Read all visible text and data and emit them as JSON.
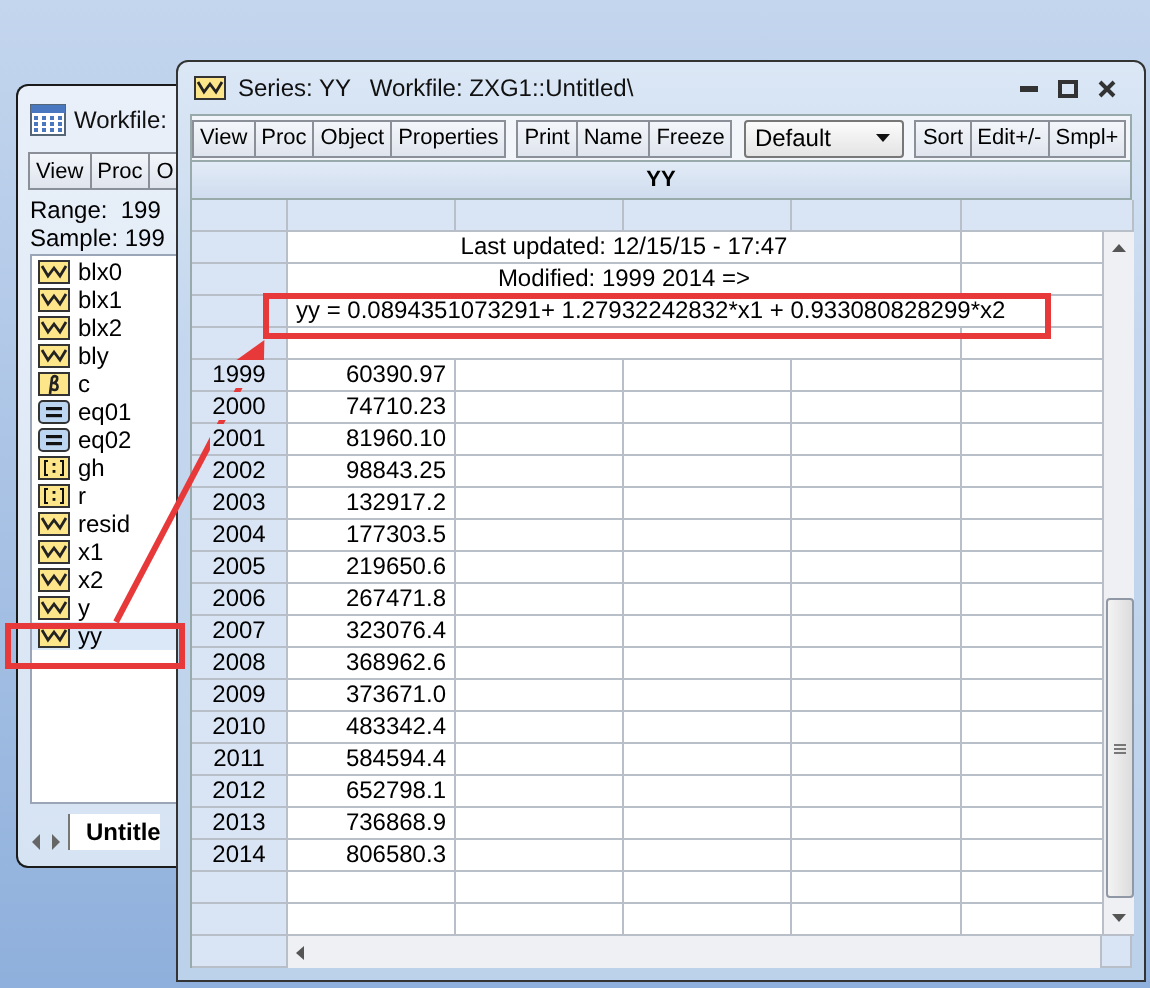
{
  "workfile_window": {
    "title": "Workfile:",
    "toolbar": [
      "View",
      "Proc",
      "O"
    ],
    "range_label": "Range:",
    "range_value": "199",
    "sample_label": "Sample:",
    "sample_value": "199",
    "objects": [
      {
        "name": "blx0",
        "kind": "series",
        "selected": false
      },
      {
        "name": "blx1",
        "kind": "series",
        "selected": false
      },
      {
        "name": "blx2",
        "kind": "series",
        "selected": false
      },
      {
        "name": "bly",
        "kind": "series",
        "selected": false
      },
      {
        "name": "c",
        "kind": "coefficient",
        "selected": false
      },
      {
        "name": "eq01",
        "kind": "equation",
        "selected": false
      },
      {
        "name": "eq02",
        "kind": "equation",
        "selected": false
      },
      {
        "name": "gh",
        "kind": "vector",
        "selected": false
      },
      {
        "name": "r",
        "kind": "vector",
        "selected": false
      },
      {
        "name": "resid",
        "kind": "series",
        "selected": false
      },
      {
        "name": "x1",
        "kind": "series",
        "selected": false
      },
      {
        "name": "x2",
        "kind": "series",
        "selected": false
      },
      {
        "name": "y",
        "kind": "series",
        "selected": false
      },
      {
        "name": "yy",
        "kind": "series",
        "selected": true
      }
    ],
    "tab": "Untitle"
  },
  "series_window": {
    "title": "Series: YY",
    "workfile": "Workfile: ZXG1::Untitled\\",
    "toolbar": [
      "View",
      "Proc",
      "Object",
      "Properties"
    ],
    "toolbar_2": [
      "Print",
      "Name",
      "Freeze"
    ],
    "view_select": "Default",
    "toolbar_3": [
      "Sort",
      "Edit+/-",
      "Smpl+"
    ],
    "sheet_title": "YY",
    "notes": [
      {
        "text": "Last updated: 12/15/15 - 17:47",
        "kind": "centered"
      },
      {
        "text": "Modified: 1999 2014 =>",
        "kind": "centered"
      },
      {
        "text": "yy = 0.0894351073291+ 1.27932242832*x1 + 0.933080828299*x2",
        "kind": "formula"
      }
    ],
    "rows": [
      {
        "label": "1999",
        "value": "60390.97"
      },
      {
        "label": "2000",
        "value": "74710.23"
      },
      {
        "label": "2001",
        "value": "81960.10"
      },
      {
        "label": "2002",
        "value": "98843.25"
      },
      {
        "label": "2003",
        "value": "132917.2"
      },
      {
        "label": "2004",
        "value": "177303.5"
      },
      {
        "label": "2005",
        "value": "219650.6"
      },
      {
        "label": "2006",
        "value": "267471.8"
      },
      {
        "label": "2007",
        "value": "323076.4"
      },
      {
        "label": "2008",
        "value": "368962.6"
      },
      {
        "label": "2009",
        "value": "373671.0"
      },
      {
        "label": "2010",
        "value": "483342.4"
      },
      {
        "label": "2011",
        "value": "584594.4"
      },
      {
        "label": "2012",
        "value": "652798.1"
      },
      {
        "label": "2013",
        "value": "736868.9"
      },
      {
        "label": "2014",
        "value": "806580.3"
      }
    ]
  }
}
